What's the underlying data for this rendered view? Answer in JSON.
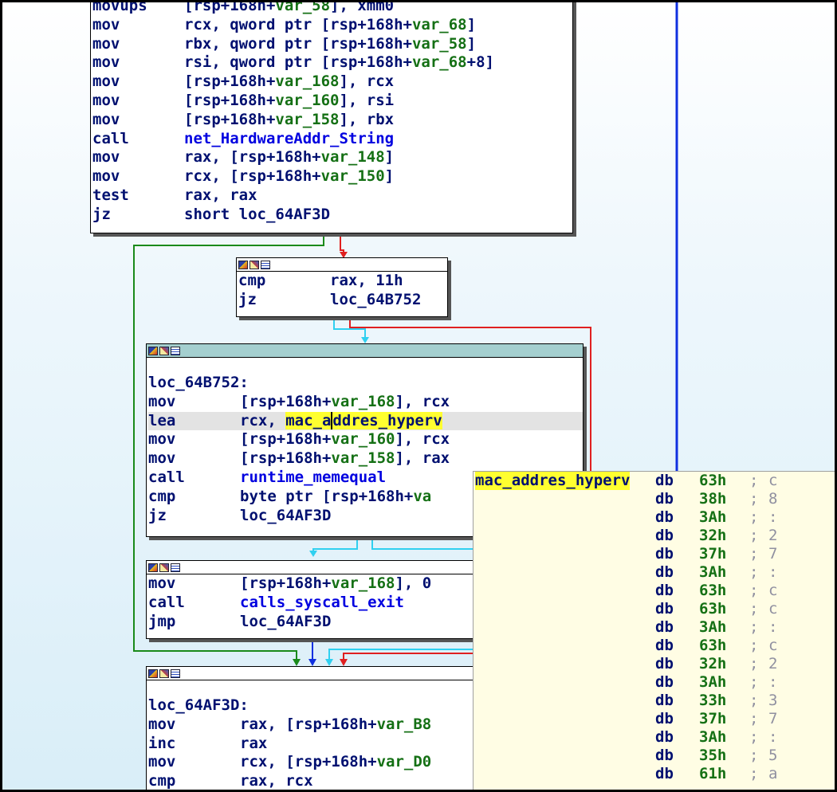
{
  "top_block": {
    "lines": [
      {
        "mn": "movups",
        "op_parts": [
          {
            "t": "[rsp+168h+",
            "c": "p"
          },
          {
            "t": "var_58",
            "c": "g"
          },
          {
            "t": "], xmm0",
            "c": "p"
          }
        ]
      },
      {
        "mn": "mov",
        "op_parts": [
          {
            "t": "rcx, qword ptr [rsp+168h+",
            "c": "p"
          },
          {
            "t": "var_68",
            "c": "g"
          },
          {
            "t": "]",
            "c": "p"
          }
        ]
      },
      {
        "mn": "mov",
        "op_parts": [
          {
            "t": "rbx, qword ptr [rsp+168h+",
            "c": "p"
          },
          {
            "t": "var_58",
            "c": "g"
          },
          {
            "t": "]",
            "c": "p"
          }
        ]
      },
      {
        "mn": "mov",
        "op_parts": [
          {
            "t": "rsi, qword ptr [rsp+168h+",
            "c": "p"
          },
          {
            "t": "var_68",
            "c": "g"
          },
          {
            "t": "+8]",
            "c": "p"
          }
        ]
      },
      {
        "mn": "mov",
        "op_parts": [
          {
            "t": "[rsp+168h+",
            "c": "p"
          },
          {
            "t": "var_168",
            "c": "g"
          },
          {
            "t": "], rcx",
            "c": "p"
          }
        ]
      },
      {
        "mn": "mov",
        "op_parts": [
          {
            "t": "[rsp+168h+",
            "c": "p"
          },
          {
            "t": "var_160",
            "c": "g"
          },
          {
            "t": "], rsi",
            "c": "p"
          }
        ]
      },
      {
        "mn": "mov",
        "op_parts": [
          {
            "t": "[rsp+168h+",
            "c": "p"
          },
          {
            "t": "var_158",
            "c": "g"
          },
          {
            "t": "], rbx",
            "c": "p"
          }
        ]
      },
      {
        "mn": "call",
        "op_parts": [
          {
            "t": "net_HardwareAddr_String",
            "c": "f"
          }
        ]
      },
      {
        "mn": "mov",
        "op_parts": [
          {
            "t": "rax, [rsp+168h+",
            "c": "p"
          },
          {
            "t": "var_148",
            "c": "g"
          },
          {
            "t": "]",
            "c": "p"
          }
        ]
      },
      {
        "mn": "mov",
        "op_parts": [
          {
            "t": "rcx, [rsp+168h+",
            "c": "p"
          },
          {
            "t": "var_150",
            "c": "g"
          },
          {
            "t": "]",
            "c": "p"
          }
        ]
      },
      {
        "mn": "test",
        "op_parts": [
          {
            "t": "rax, rax",
            "c": "p"
          }
        ]
      },
      {
        "mn": "jz",
        "op_parts": [
          {
            "t": "short loc_64AF3D",
            "c": "p"
          }
        ]
      }
    ]
  },
  "cmp_block": {
    "lines": [
      {
        "mn": "cmp",
        "op_parts": [
          {
            "t": "rax, 11h",
            "c": "p"
          }
        ]
      },
      {
        "mn": "jz",
        "op_parts": [
          {
            "t": "loc_64B752",
            "c": "p"
          }
        ]
      }
    ]
  },
  "loc_block": {
    "label": "loc_64B752:",
    "lines": [
      {
        "mn": "mov",
        "op_parts": [
          {
            "t": "[rsp+168h+",
            "c": "p"
          },
          {
            "t": "var_168",
            "c": "g"
          },
          {
            "t": "], rcx",
            "c": "p"
          }
        ]
      },
      {
        "mn": "lea",
        "highlight": true,
        "op_parts": [
          {
            "t": "rcx, ",
            "c": "p"
          },
          {
            "t": "mac_a",
            "c": "r"
          },
          {
            "t": "ddres_hyperv",
            "c": "rc"
          }
        ]
      },
      {
        "mn": "mov",
        "op_parts": [
          {
            "t": "[rsp+168h+",
            "c": "p"
          },
          {
            "t": "var_160",
            "c": "g"
          },
          {
            "t": "], rcx",
            "c": "p"
          }
        ]
      },
      {
        "mn": "mov",
        "op_parts": [
          {
            "t": "[rsp+168h+",
            "c": "p"
          },
          {
            "t": "var_158",
            "c": "g"
          },
          {
            "t": "], rax",
            "c": "p"
          }
        ]
      },
      {
        "mn": "call",
        "op_parts": [
          {
            "t": "runtime_memequal",
            "c": "f"
          }
        ]
      },
      {
        "mn": "cmp",
        "op_parts": [
          {
            "t": "byte ptr [rsp+168h+",
            "c": "p"
          },
          {
            "t": "va",
            "c": "g"
          }
        ]
      },
      {
        "mn": "jz",
        "op_parts": [
          {
            "t": "loc_64AF3D",
            "c": "p"
          }
        ]
      }
    ]
  },
  "exit_block": {
    "lines": [
      {
        "mn": "mov",
        "op_parts": [
          {
            "t": "[rsp+168h+",
            "c": "p"
          },
          {
            "t": "var_168",
            "c": "g"
          },
          {
            "t": "], 0",
            "c": "p"
          }
        ]
      },
      {
        "mn": "call",
        "op_parts": [
          {
            "t": "calls_syscall_exit",
            "c": "f"
          }
        ]
      },
      {
        "mn": "jmp",
        "op_parts": [
          {
            "t": "loc_64AF3D",
            "c": "p"
          }
        ]
      }
    ]
  },
  "bottom_block": {
    "label": "loc_64AF3D:",
    "lines": [
      {
        "mn": "mov",
        "op_parts": [
          {
            "t": "rax, [rsp+168h+",
            "c": "p"
          },
          {
            "t": "var_B8",
            "c": "g"
          }
        ]
      },
      {
        "mn": "inc",
        "op_parts": [
          {
            "t": "rax",
            "c": "p"
          }
        ]
      },
      {
        "mn": "mov",
        "op_parts": [
          {
            "t": "rcx, [rsp+168h+",
            "c": "p"
          },
          {
            "t": "var_D0",
            "c": "g"
          }
        ]
      },
      {
        "mn": "cmp",
        "op_parts": [
          {
            "t": "rax, rcx",
            "c": "p"
          }
        ]
      }
    ]
  },
  "popup": {
    "name": "mac_addres_hyperv",
    "entries": [
      {
        "d": "db",
        "v": "63h",
        "c": ";",
        "ch": "c"
      },
      {
        "d": "db",
        "v": "38h",
        "c": ";",
        "ch": "8"
      },
      {
        "d": "db",
        "v": "3Ah",
        "c": ";",
        "ch": ":"
      },
      {
        "d": "db",
        "v": "32h",
        "c": ";",
        "ch": "2"
      },
      {
        "d": "db",
        "v": "37h",
        "c": ";",
        "ch": "7"
      },
      {
        "d": "db",
        "v": "3Ah",
        "c": ";",
        "ch": ":"
      },
      {
        "d": "db",
        "v": "63h",
        "c": ";",
        "ch": "c"
      },
      {
        "d": "db",
        "v": "63h",
        "c": ";",
        "ch": "c"
      },
      {
        "d": "db",
        "v": "3Ah",
        "c": ";",
        "ch": ":"
      },
      {
        "d": "db",
        "v": "63h",
        "c": ";",
        "ch": "c"
      },
      {
        "d": "db",
        "v": "32h",
        "c": ";",
        "ch": "2"
      },
      {
        "d": "db",
        "v": "3Ah",
        "c": ";",
        "ch": ":"
      },
      {
        "d": "db",
        "v": "33h",
        "c": ";",
        "ch": "3"
      },
      {
        "d": "db",
        "v": "37h",
        "c": ";",
        "ch": "7"
      },
      {
        "d": "db",
        "v": "3Ah",
        "c": ";",
        "ch": ":"
      },
      {
        "d": "db",
        "v": "35h",
        "c": ";",
        "ch": "5"
      },
      {
        "d": "db",
        "v": "61h",
        "c": ";",
        "ch": "a"
      }
    ]
  },
  "colors": {
    "true_edge": "#1a8a1a",
    "false_edge": "#e02020",
    "uncond_edge": "#1030e0",
    "cyan_edge": "#30d0f0",
    "reference_highlight": "#ffff30",
    "popup_bg": "#fffde4"
  },
  "icons": [
    "graph-view-icon",
    "edit-icon",
    "list-view-icon"
  ]
}
